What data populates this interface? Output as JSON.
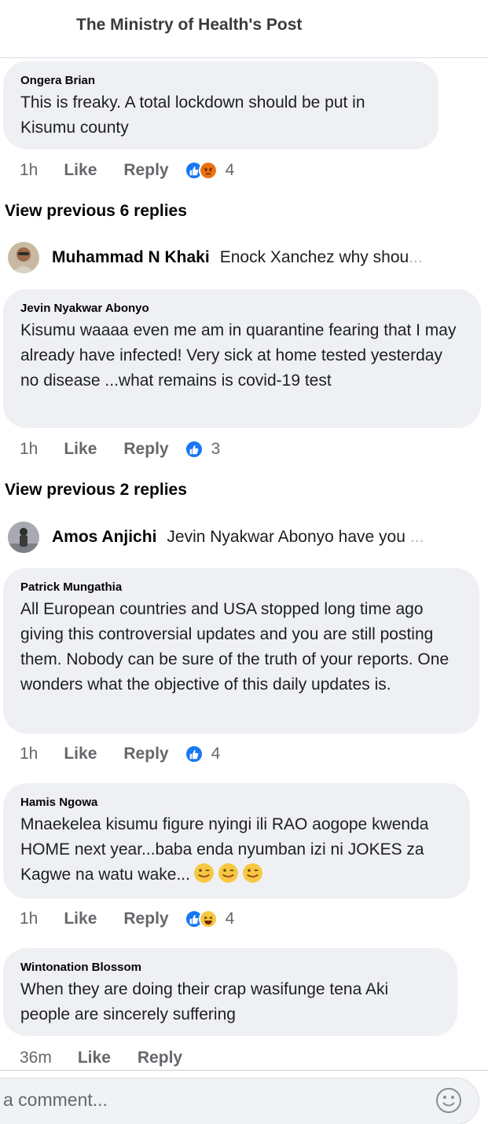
{
  "header": {
    "title": "The Ministry of Health's Post"
  },
  "actions": {
    "like": "Like",
    "reply": "Reply"
  },
  "comments": [
    {
      "author": "Ongera Brian",
      "text": "This is freaky. A total lockdown should be put in Kisumu county",
      "time": "1h",
      "reactions": [
        "like-icon",
        "angry-icon"
      ],
      "reaction_count": "4"
    },
    {
      "author": "Jevin Nyakwar Abonyo",
      "text": "Kisumu waaaa even me am in quarantine fearing that I may already have infected! Very sick at home tested yesterday no disease ...what remains is covid-19 test",
      "time": "1h",
      "reactions": [
        "like-icon"
      ],
      "reaction_count": "3"
    },
    {
      "author": "Patrick Mungathia",
      "text": "All European countries and USA stopped long time ago giving this controversial updates and you are still posting them. Nobody can be sure of the truth of your reports. One wonders what the objective of this daily updates is.",
      "time": "1h",
      "reactions": [
        "like-icon"
      ],
      "reaction_count": "4"
    },
    {
      "author": "Hamis Ngowa",
      "text": "Mnaekelea kisumu figure nyingi ili RAO aogope kwenda HOME next year...baba enda nyumban izi ni JOKES za Kagwe na watu wake...",
      "emojis": [
        "winking-tongue-emoji",
        "winking-tongue-emoji",
        "winking-tongue-emoji"
      ],
      "time": "1h",
      "reactions": [
        "like-icon",
        "haha-icon"
      ],
      "reaction_count": "4"
    },
    {
      "author": "Wintonation Blossom",
      "text": "When they are doing their crap wasifunge tena Aki people are sincerely suffering",
      "time": "36m"
    }
  ],
  "view_previous": [
    {
      "label": "View previous 6 replies"
    },
    {
      "label": "View previous 2 replies"
    }
  ],
  "reply_previews": [
    {
      "name": "Muhammad N Khaki",
      "text": "Enock Xanchez why shou",
      "ellipsis": "..."
    },
    {
      "name": "Amos Anjichi",
      "text": "Jevin Nyakwar Abonyo have you",
      "ellipsis": "..."
    }
  ],
  "composer": {
    "placeholder": "a comment...",
    "emoji_icon": "smiley-icon"
  },
  "colors": {
    "bubble": "#eff0f4",
    "like_blue": "#1877f2",
    "meta_grey": "#65676b"
  }
}
